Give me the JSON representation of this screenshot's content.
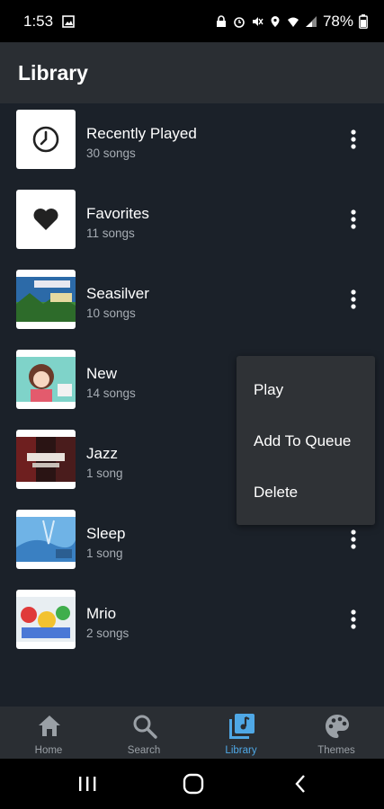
{
  "status_bar": {
    "time": "1:53",
    "battery": "78%",
    "icons": [
      "image-icon",
      "lock-icon",
      "alarm-icon",
      "mute-icon",
      "location-icon",
      "wifi-icon",
      "signal-icon",
      "battery-icon"
    ]
  },
  "header": {
    "title": "Library"
  },
  "playlists": [
    {
      "title": "Recently Played",
      "subtitle": "30 songs",
      "thumb": "clock-icon"
    },
    {
      "title": "Favorites",
      "subtitle": "11 songs",
      "thumb": "heart-icon"
    },
    {
      "title": "Seasilver",
      "subtitle": "10 songs",
      "thumb": "cover-art"
    },
    {
      "title": "New",
      "subtitle": "14 songs",
      "thumb": "cover-art"
    },
    {
      "title": "Jazz",
      "subtitle": "1 song",
      "thumb": "cover-art"
    },
    {
      "title": "Sleep",
      "subtitle": "1 song",
      "thumb": "cover-art"
    },
    {
      "title": "Mrio",
      "subtitle": "2 songs",
      "thumb": "cover-art"
    }
  ],
  "context_menu": {
    "items": [
      "Play",
      "Add To Queue",
      "Delete"
    ]
  },
  "bottom_nav": {
    "items": [
      {
        "label": "Home",
        "icon": "home-icon"
      },
      {
        "label": "Search",
        "icon": "search-icon"
      },
      {
        "label": "Library",
        "icon": "library-icon",
        "active": true
      },
      {
        "label": "Themes",
        "icon": "palette-icon"
      }
    ]
  },
  "colors": {
    "background": "#1b2129",
    "app_bar": "#2a2e33",
    "accent": "#4fa8e6",
    "menu": "#2f3236"
  }
}
